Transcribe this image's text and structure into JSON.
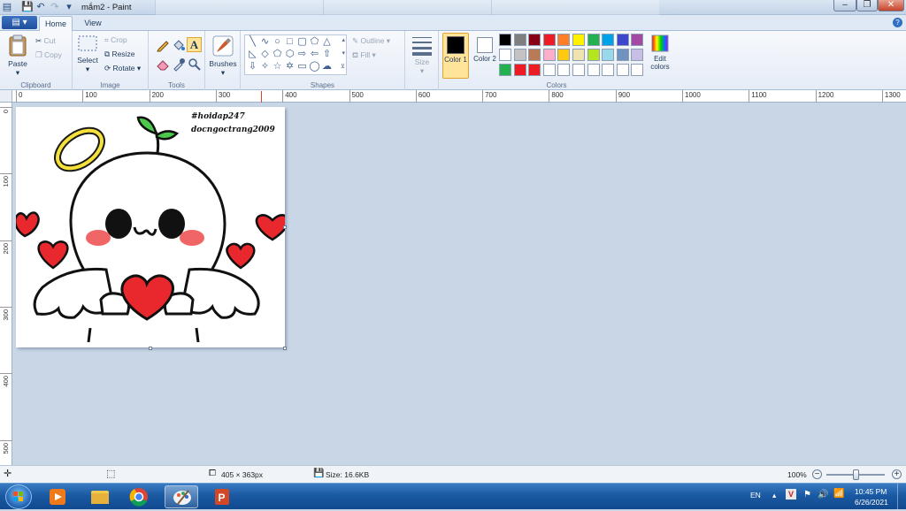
{
  "window": {
    "title": "mắm2 - Paint",
    "controls": {
      "minimize": "–",
      "maximize": "❐",
      "close": "✕"
    }
  },
  "tabs": {
    "file_label": "▤ ▾",
    "home": "Home",
    "view": "View"
  },
  "clipboard": {
    "paste": "Paste",
    "cut": "Cut",
    "copy": "Copy",
    "group": "Clipboard"
  },
  "image": {
    "select": "Select",
    "crop": "Crop",
    "resize": "Resize",
    "rotate": "Rotate ▾",
    "group": "Image"
  },
  "tools": {
    "group": "Tools"
  },
  "brushes": {
    "label": "Brushes"
  },
  "shapes": {
    "outline": "Outline ▾",
    "fill": "Fill ▾",
    "group": "Shapes"
  },
  "size": {
    "label": "Size"
  },
  "colors": {
    "color1_label": "Color 1",
    "color2_label": "Color 2",
    "edit_label": "Edit colors",
    "group": "Colors",
    "color1": "#000000",
    "color2": "#ffffff",
    "palette_row1": [
      "#000000",
      "#7f7f7f",
      "#880015",
      "#ed1c24",
      "#ff7f27",
      "#fff200",
      "#22b14c",
      "#00a2e8",
      "#3f48cc",
      "#a349a4"
    ],
    "palette_row2": [
      "#ffffff",
      "#c3c3c3",
      "#b97a57",
      "#ffaec9",
      "#ffc90e",
      "#efe4b0",
      "#b5e61d",
      "#99d9ea",
      "#7092be",
      "#c8bfe7"
    ],
    "palette_row3": [
      "#22b14c",
      "#ed1c24",
      "#ed1c24",
      "#ffffff",
      "#ffffff",
      "#ffffff",
      "#ffffff",
      "#ffffff",
      "#ffffff",
      "#ffffff"
    ]
  },
  "ruler_h": [
    "0",
    "100",
    "200",
    "300",
    "400",
    "500",
    "600",
    "700",
    "800",
    "900",
    "1000",
    "1100",
    "1200",
    "1300"
  ],
  "ruler_v": [
    "0",
    "100",
    "200",
    "300",
    "400",
    "500"
  ],
  "canvas_text": {
    "line1": "#hoidap247",
    "line2": "docngoctrang2009"
  },
  "status": {
    "dimensions": "405 × 363px",
    "size": "Size: 16.6KB",
    "zoom": "100%"
  },
  "taskbar": {
    "lang": "EN",
    "time": "10:45 PM",
    "date": "6/26/2021"
  }
}
